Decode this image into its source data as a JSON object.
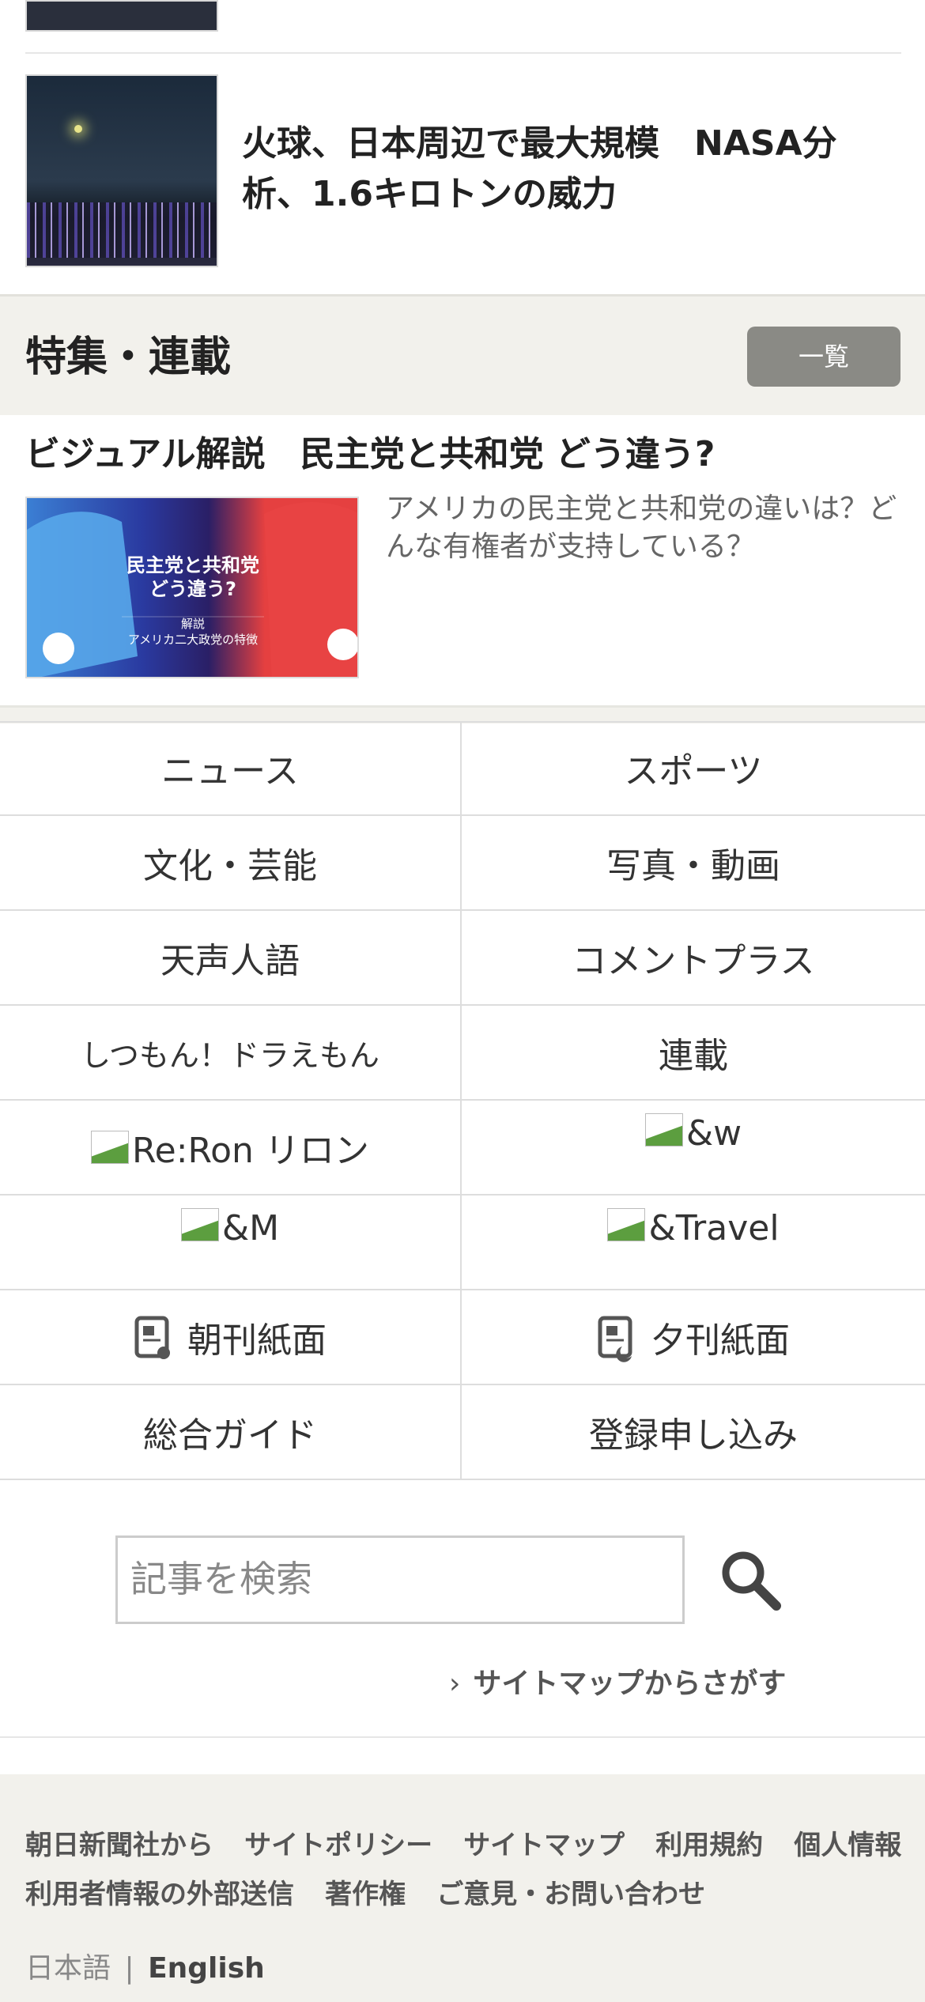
{
  "top_article": {
    "headline": "火球、日本周辺で最大規模　NASA分析、1.6キロトンの威力"
  },
  "features": {
    "title": "特集・連載",
    "list_button": "一覧",
    "item": {
      "title": "ビジュアル解説　民主党と共和党 どう違う?",
      "description": "アメリカの民主党と共和党の違いは？どんな有権者が支持している？",
      "image_text": {
        "main": "民主党と共和党\nどう違う?",
        "sub1": "解説",
        "sub2": "アメリカ二大政党の特徴"
      }
    }
  },
  "nav_grid": [
    {
      "label": "ニュース",
      "icon": null
    },
    {
      "label": "スポーツ",
      "icon": null
    },
    {
      "label": "文化・芸能",
      "icon": null
    },
    {
      "label": "写真・動画",
      "icon": null
    },
    {
      "label": "天声人語",
      "icon": null
    },
    {
      "label": "コメントプラス",
      "icon": null
    },
    {
      "label": "しつもん！ドラえもん",
      "icon": null
    },
    {
      "label": "連載",
      "icon": null
    },
    {
      "label": "Re:Ron リロン",
      "icon": "broken-image-icon"
    },
    {
      "label": "&w",
      "icon": "broken-image-icon"
    },
    {
      "label": "&M",
      "icon": "broken-image-icon"
    },
    {
      "label": "&Travel",
      "icon": "broken-image-icon"
    },
    {
      "label": "朝刊紙面",
      "icon": "morning-paper-icon"
    },
    {
      "label": "夕刊紙面",
      "icon": "evening-paper-icon"
    },
    {
      "label": "総合ガイド",
      "icon": null
    },
    {
      "label": "登録申し込み",
      "icon": null
    }
  ],
  "search": {
    "placeholder": "記事を検索",
    "sitemap_link": "サイトマップからさがす"
  },
  "footer": {
    "links_row1": [
      "朝日新聞社から",
      "サイトポリシー",
      "サイトマップ",
      "利用規約",
      "個人情報"
    ],
    "links_row2": [
      "利用者情報の外部送信",
      "著作権",
      "ご意見・お問い合わせ"
    ],
    "lang_ja": "日本語",
    "lang_separator": "|",
    "lang_en": "English"
  },
  "colors": {
    "band": "#f2f1ec",
    "button": "#8a8a85",
    "democrat": "#2f7fd0",
    "republican": "#e33b3b"
  }
}
